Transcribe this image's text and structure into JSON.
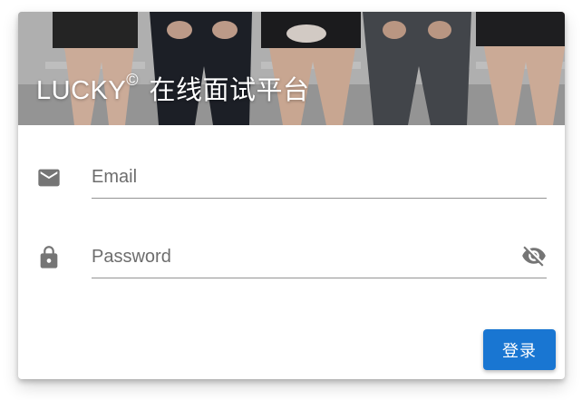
{
  "header": {
    "brand": "LUCKY",
    "copyright_mark": "©",
    "title_suffix": " 在线面试平台"
  },
  "form": {
    "email": {
      "placeholder": "Email",
      "value": "",
      "icon": "email-icon"
    },
    "password": {
      "placeholder": "Password",
      "value": "",
      "icon": "lock-icon",
      "toggle_icon": "visibility-off-icon"
    },
    "submit_label": "登录"
  },
  "colors": {
    "primary": "#1976d2",
    "icon": "#757575",
    "underline": "#949494"
  }
}
